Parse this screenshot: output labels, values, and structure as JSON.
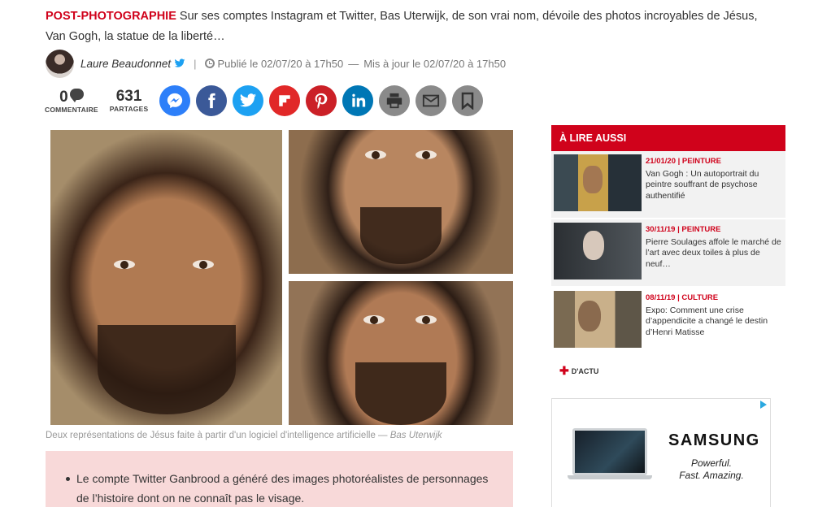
{
  "lede": {
    "kicker": "POST-PHOTOGRAPHIE",
    "text": " Sur ses comptes Instagram et Twitter, Bas Uterwijk, de son vrai nom, dévoile des photos incroyables de Jésus, Van Gogh, la statue de la liberté…"
  },
  "byline": {
    "author": "Laure Beaudonnet",
    "separator": "|",
    "published": "Publié le 02/07/20 à 17h50",
    "dash": "—",
    "updated": "Mis à jour le 02/07/20 à 17h50"
  },
  "counters": {
    "comments": {
      "value": "0",
      "label": "COMMENTAIRE"
    },
    "shares": {
      "value": "631",
      "label": "PARTAGES"
    }
  },
  "share_buttons": [
    {
      "name": "messenger-share-button",
      "icon": "messenger-icon",
      "color": "#2d7ff9"
    },
    {
      "name": "facebook-share-button",
      "icon": "facebook-icon",
      "color": "#3b5998"
    },
    {
      "name": "twitter-share-button",
      "icon": "twitter-icon",
      "color": "#1da1f2"
    },
    {
      "name": "flipboard-share-button",
      "icon": "flipboard-icon",
      "color": "#e12828"
    },
    {
      "name": "pinterest-share-button",
      "icon": "pinterest-icon",
      "color": "#cb2027"
    },
    {
      "name": "linkedin-share-button",
      "icon": "linkedin-icon",
      "color": "#0077b5"
    },
    {
      "name": "print-button",
      "icon": "printer-icon",
      "color": "#8a8a8a"
    },
    {
      "name": "email-share-button",
      "icon": "envelope-icon",
      "color": "#8a8a8a"
    },
    {
      "name": "bookmark-button",
      "icon": "bookmark-icon",
      "color": "#8a8a8a"
    }
  ],
  "caption": {
    "text": "Deux représentations de Jésus faite à partir d'un logiciel d'intelligence artificielle — ",
    "credit": "Bas Uterwijk"
  },
  "summary": {
    "bullet": "Le compte Twitter Ganbrood a généré des images photoréalistes de personnages de l’histoire dont on ne connaît pas le visage."
  },
  "aside": {
    "title": "À LIRE AUSSI",
    "items": [
      {
        "meta": "21/01/20 | PEINTURE",
        "title": "Van Gogh : Un autoportrait du peintre souffrant de psychose authentifié"
      },
      {
        "meta": "30/11/19 | PEINTURE",
        "title": "Pierre Soulages affole le marché de l’art avec deux toiles à plus de neuf…"
      },
      {
        "meta": "08/11/19 | CULTURE",
        "title": "Expo: Comment une crise d’appendicite a changé le destin d’Henri Matisse"
      }
    ],
    "more_label": "D'ACTU",
    "more_symbol": "✚"
  },
  "ad": {
    "brand": "SAMSUNG",
    "slogan": "Powerful. Fast. Amazing."
  },
  "colors": {
    "accent": "#d0021b",
    "summary_bg": "#f8d9d9"
  }
}
